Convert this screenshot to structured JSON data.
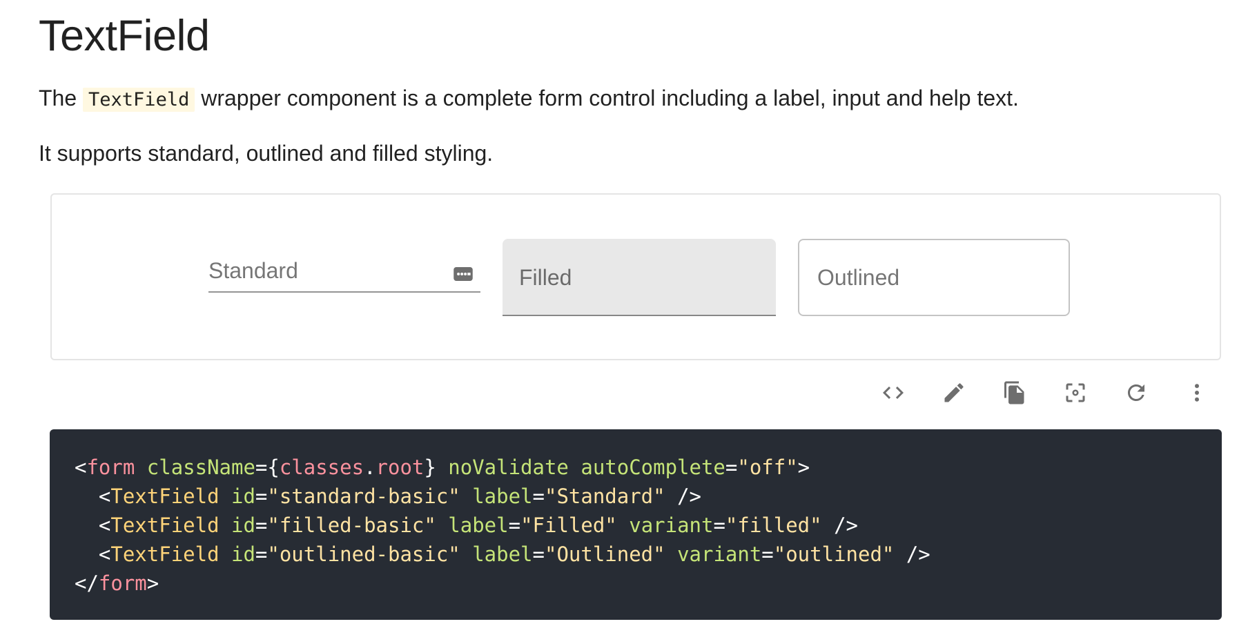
{
  "heading": "TextField",
  "intro": {
    "before": "The ",
    "code": "TextField",
    "after": " wrapper component is a complete form control including a label, input and help text."
  },
  "support_text": "It supports standard, outlined and filled styling.",
  "demo": {
    "standard_label": "Standard",
    "standard_icon": "password-key-icon",
    "filled_label": "Filled",
    "outlined_label": "Outlined"
  },
  "toolbar": {
    "icons": [
      "code-icon",
      "edit-icon",
      "copy-icon",
      "reset-focus-icon",
      "refresh-icon",
      "more-vert-icon"
    ]
  },
  "code": {
    "line1": {
      "open": "<",
      "tag": "form",
      "attr1": "className",
      "eq1": "={",
      "val1a": "classes",
      "dot": ".",
      "val1b": "root",
      "close1": "} ",
      "attr2": "noValidate",
      "attr3": "autoComplete",
      "eq3": "=",
      "val3": "\"off\"",
      "end": ">"
    },
    "line2": {
      "open": "<",
      "comp": "TextField",
      "attr1": "id",
      "val1": "\"standard-basic\"",
      "attr2": "label",
      "val2": "\"Standard\"",
      "end": " />"
    },
    "line3": {
      "open": "<",
      "comp": "TextField",
      "attr1": "id",
      "val1": "\"filled-basic\"",
      "attr2": "label",
      "val2": "\"Filled\"",
      "attr3": "variant",
      "val3": "\"filled\"",
      "end": " />"
    },
    "line4": {
      "open": "<",
      "comp": "TextField",
      "attr1": "id",
      "val1": "\"outlined-basic\"",
      "attr2": "label",
      "val2": "\"Outlined\"",
      "attr3": "variant",
      "val3": "\"outlined\"",
      "end": " />"
    },
    "line5": {
      "open": "</",
      "tag": "form",
      "end": ">"
    }
  },
  "colors": {
    "code_bg": "#272c34",
    "tag": "#fc929e",
    "component": "#ffd479",
    "attribute": "#c5e478",
    "string": "#ffe3a3",
    "inline_code_bg": "#fff8e1"
  }
}
